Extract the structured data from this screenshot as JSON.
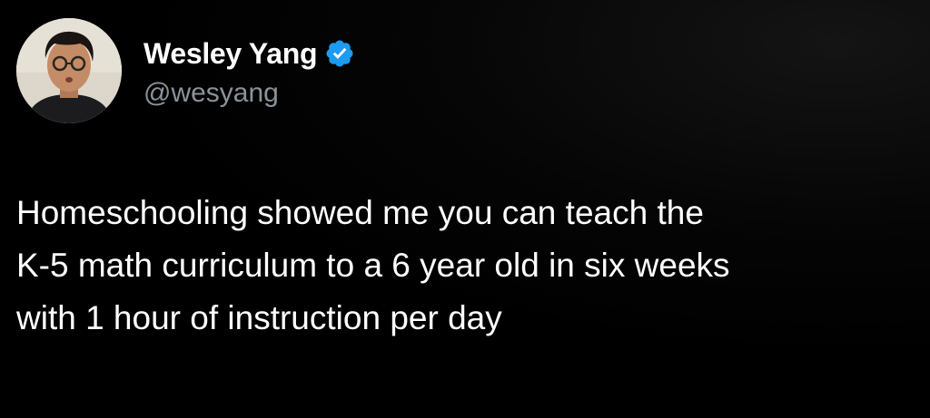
{
  "author": {
    "display_name": "Wesley Yang",
    "handle": "@wesyang",
    "verified": true,
    "avatar_icon": "profile-photo"
  },
  "tweet": {
    "text_lines": [
      "Homeschooling showed me you can teach the",
      "K-5 math curriculum to a 6 year old in six weeks",
      "with 1 hour of instruction per day"
    ]
  },
  "colors": {
    "background": "#000000",
    "name": "#ffffff",
    "handle": "#8b9298",
    "verified_badge": "#1d9bf0",
    "text": "#ffffff"
  }
}
